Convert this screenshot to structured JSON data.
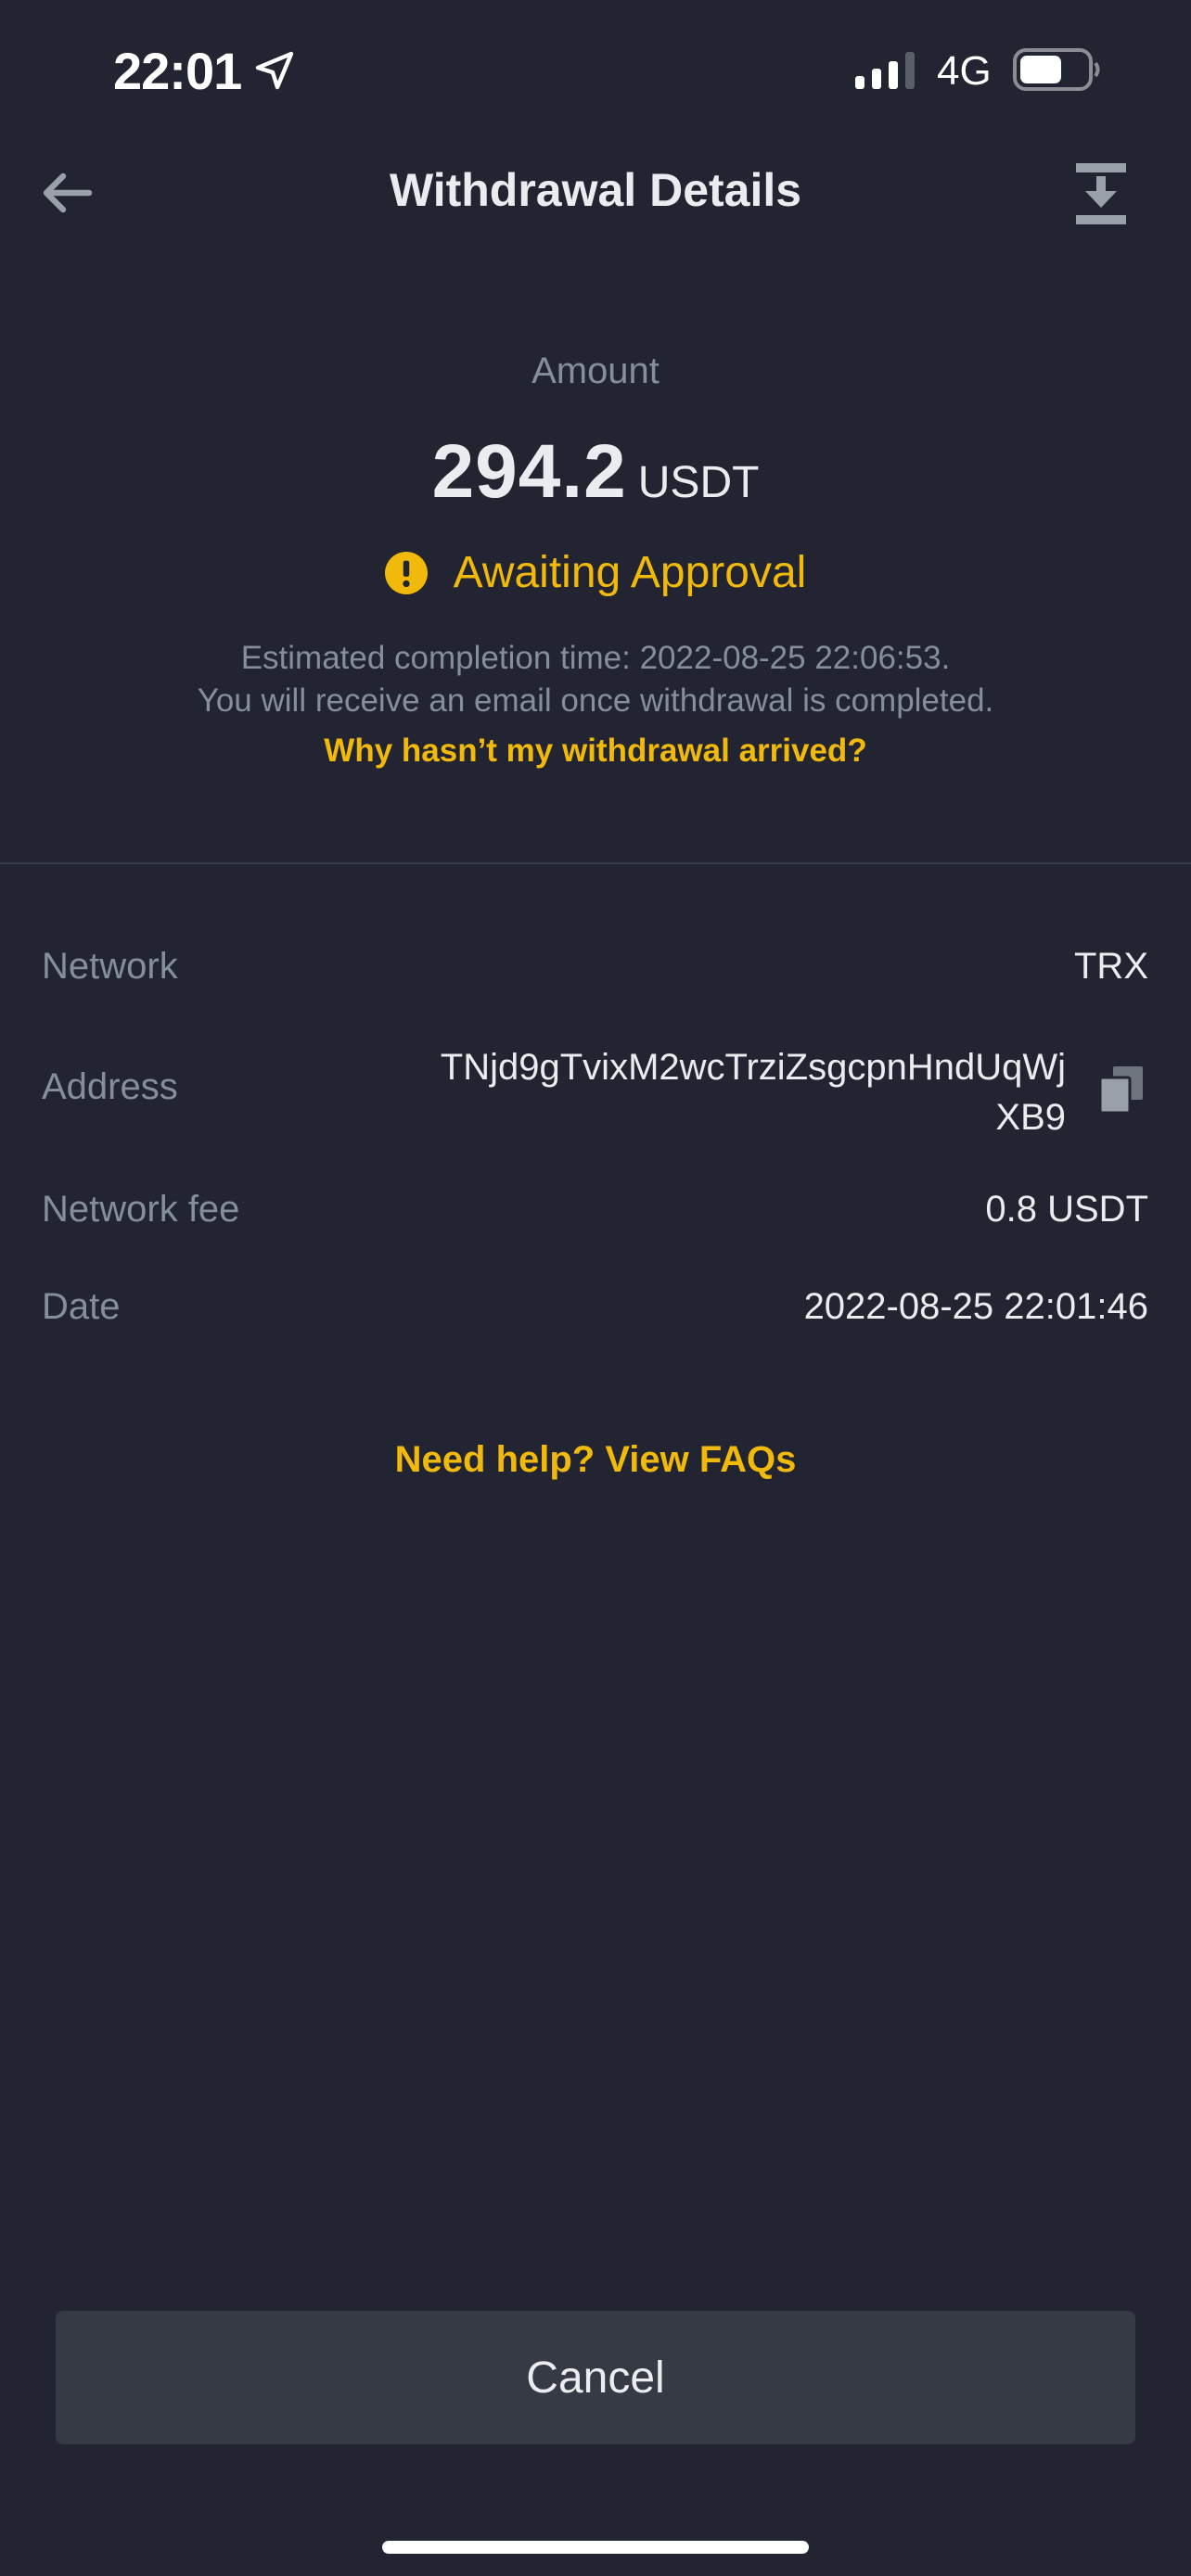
{
  "status_bar": {
    "time": "22:01",
    "network": "4G",
    "icons": [
      "location-arrow-icon",
      "signal-icon",
      "battery-icon"
    ]
  },
  "nav": {
    "title": "Withdrawal Details",
    "icons": [
      "back-arrow-icon",
      "download-icon"
    ]
  },
  "amount": {
    "label": "Amount",
    "value": "294.2",
    "unit": "USDT"
  },
  "status": {
    "text": "Awaiting Approval",
    "icon": "warning-icon",
    "color": "#f0b90b"
  },
  "notes": {
    "line1": "Estimated completion time: 2022-08-25 22:06:53.",
    "line2": "You will receive an email once withdrawal is completed.",
    "help_link": "Why hasn’t my withdrawal arrived?"
  },
  "details": {
    "network_label": "Network",
    "network_value": "TRX",
    "address_label": "Address",
    "address_value": "TNjd9gTvixM2wcTrziZsgcpnHndUqWjXB9",
    "fee_label": "Network fee",
    "fee_value": "0.8 USDT",
    "date_label": "Date",
    "date_value": "2022-08-25 22:01:46"
  },
  "faq_link": "Need help? View FAQs",
  "cancel_label": "Cancel",
  "colors": {
    "background": "#222531",
    "accent": "#f0b90b",
    "muted_text": "#848e9c",
    "primary_text": "#eaecef",
    "button_bg": "#363a45"
  }
}
